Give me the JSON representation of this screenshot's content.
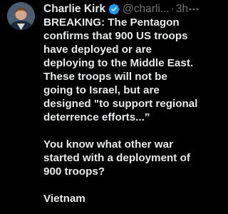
{
  "tweet": {
    "author_name": "Charlie Kirk",
    "handle": "@charli...",
    "separator": "·",
    "time": "3h",
    "paragraphs": [
      "BREAKING: The Pentagon confirms that 900 US troops have deployed or are deploying to the Middle East. These troops will not be going to Israel, but are designed \"to support regional deterrence efforts...”",
      "You know what other war started with a deployment of 900 troops?",
      "Vietnam"
    ]
  },
  "icons": {
    "verified": "verified-badge-icon",
    "more": "more-options-icon"
  },
  "colors": {
    "background": "#000000",
    "text": "#e7e9ea",
    "secondary_text": "#71767b",
    "verified_blue": "#1d9bf0"
  }
}
